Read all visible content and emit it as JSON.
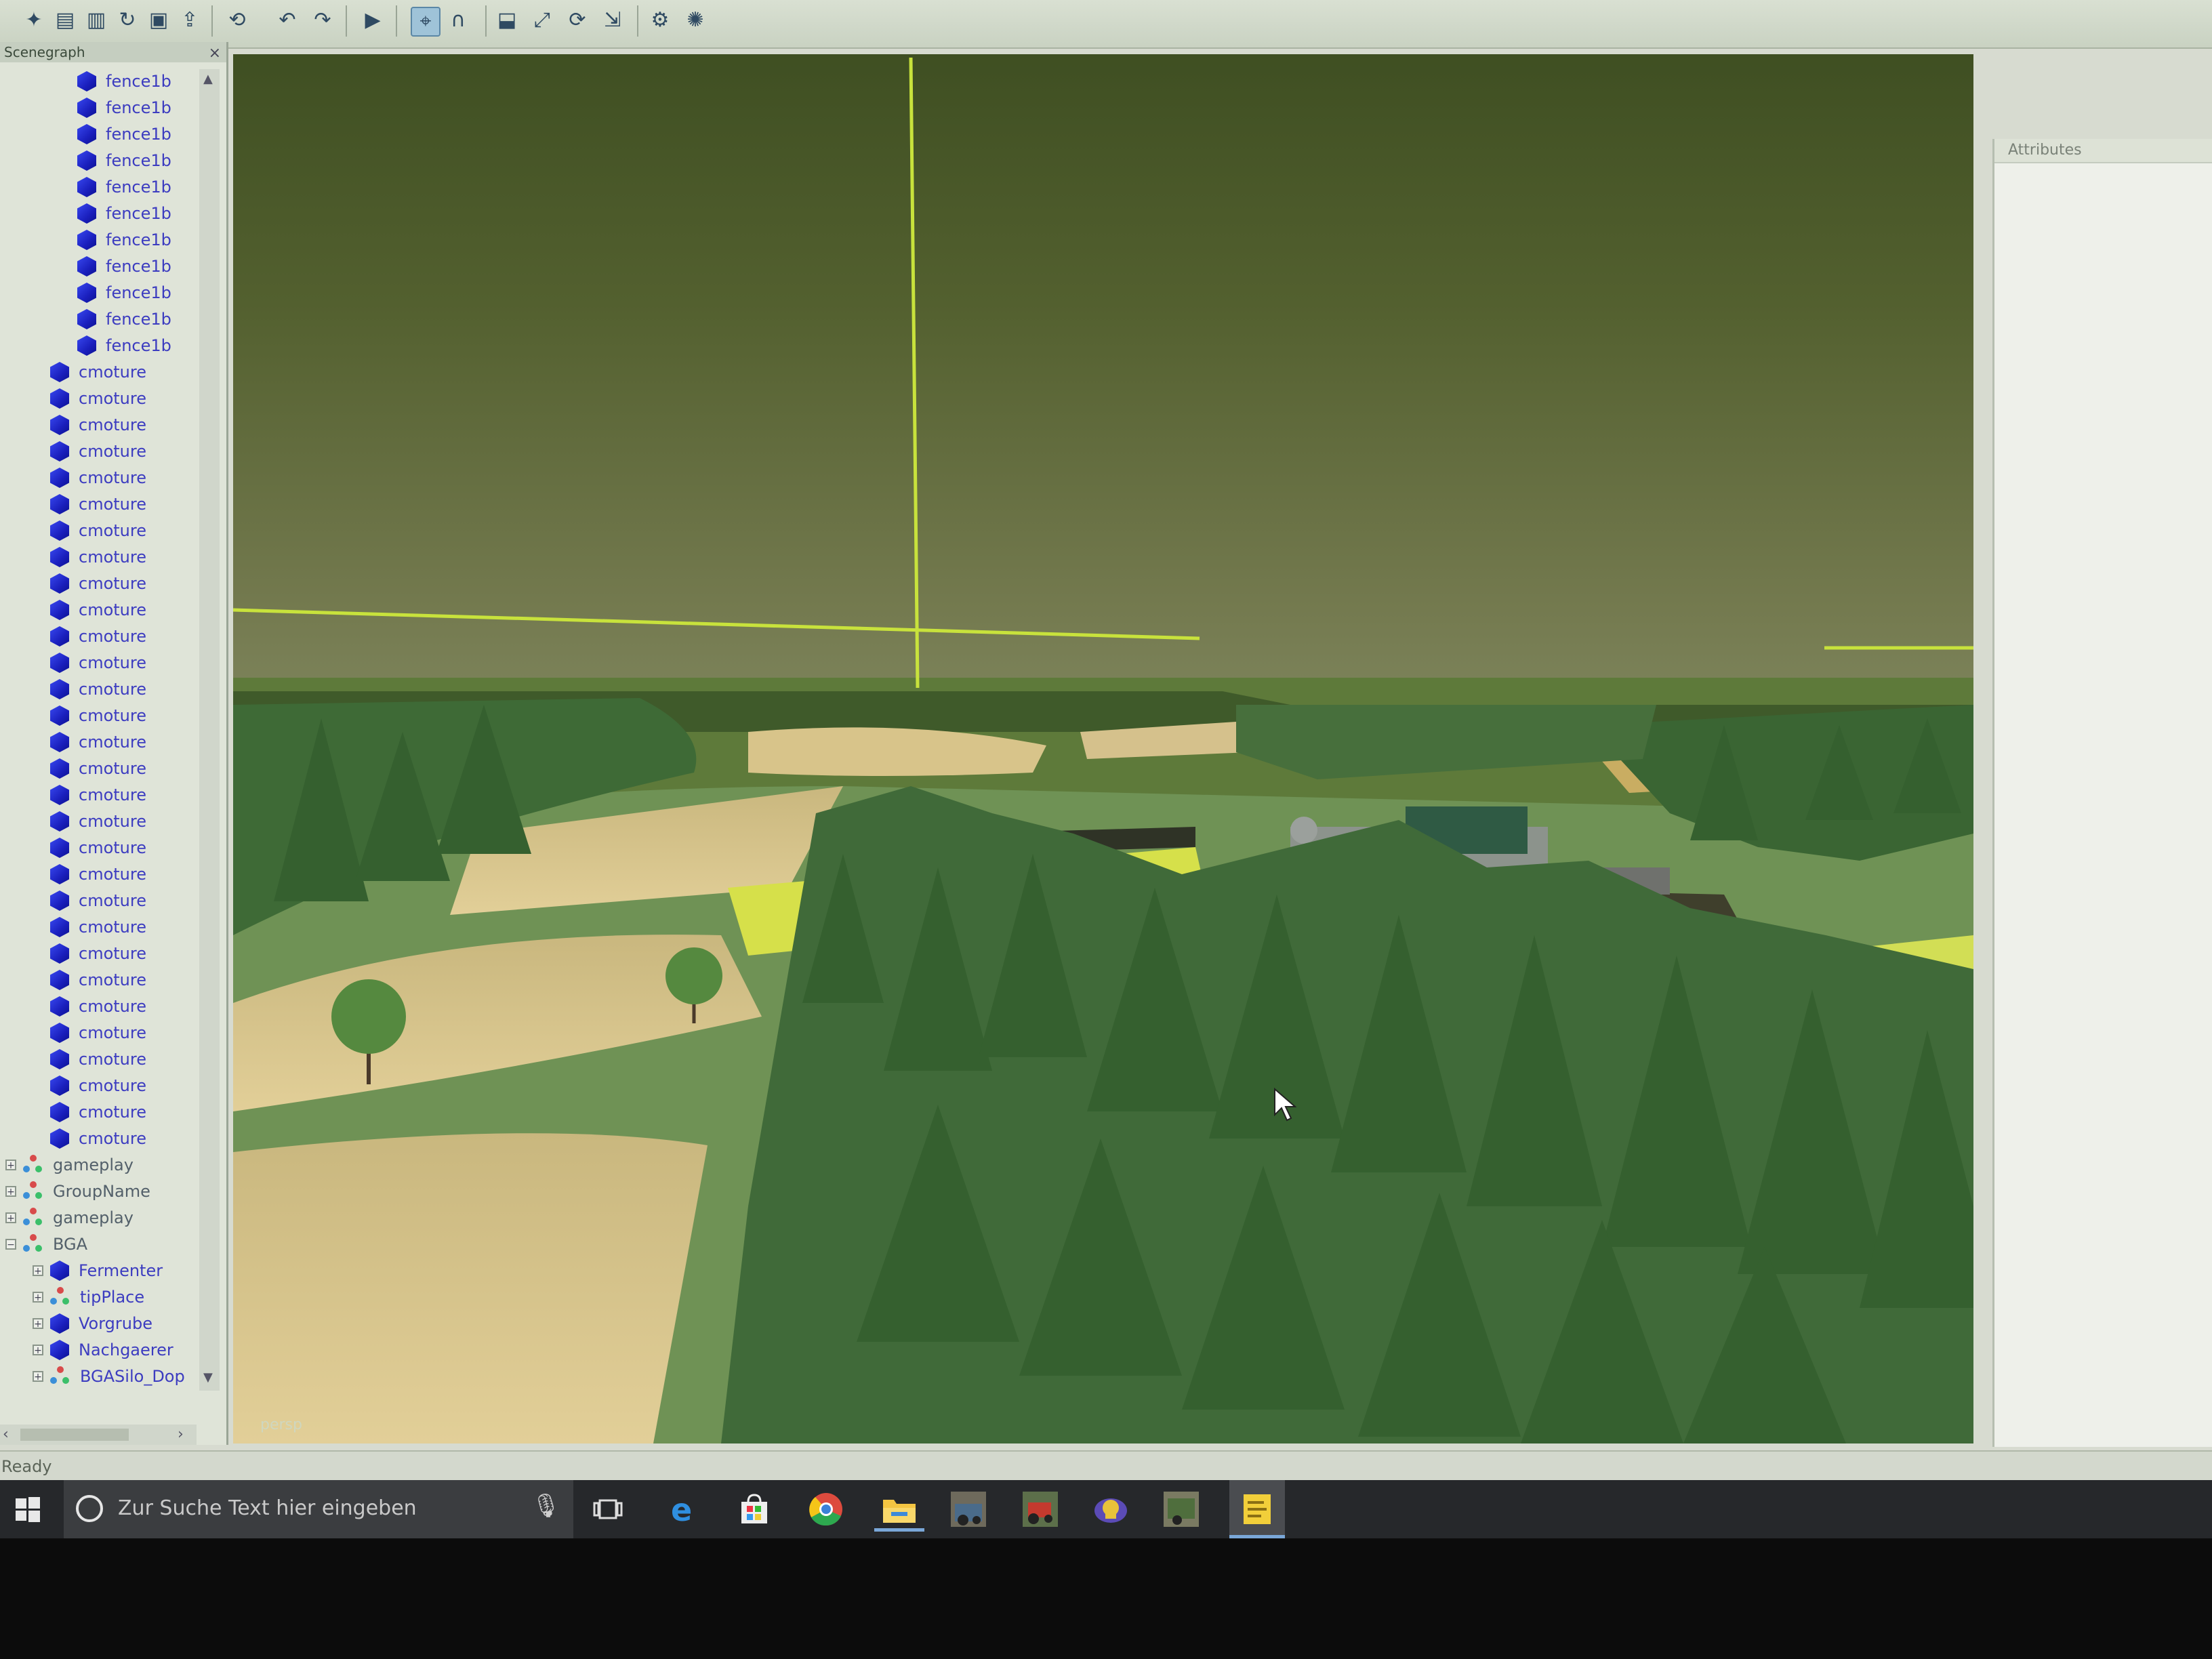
{
  "toolbar": {
    "buttons": [
      "new-file",
      "open-file",
      "save-file",
      "refresh",
      "save",
      "export",
      "undo-history",
      "undo",
      "redo",
      "play",
      "select-tool",
      "magnet-tool",
      "import",
      "move-tool",
      "rotate-tool",
      "scale-tool",
      "settings",
      "help"
    ]
  },
  "scenegraph": {
    "title": "Scenegraph",
    "close_glyph": "×",
    "nodes": [
      {
        "label": "fence1b",
        "icon": "shape",
        "indent": 2
      },
      {
        "label": "fence1b",
        "icon": "shape",
        "indent": 2
      },
      {
        "label": "fence1b",
        "icon": "shape",
        "indent": 2
      },
      {
        "label": "fence1b",
        "icon": "shape",
        "indent": 2
      },
      {
        "label": "fence1b",
        "icon": "shape",
        "indent": 2
      },
      {
        "label": "fence1b",
        "icon": "shape",
        "indent": 2
      },
      {
        "label": "fence1b",
        "icon": "shape",
        "indent": 2
      },
      {
        "label": "fence1b",
        "icon": "shape",
        "indent": 2
      },
      {
        "label": "fence1b",
        "icon": "shape",
        "indent": 2
      },
      {
        "label": "fence1b",
        "icon": "shape",
        "indent": 2
      },
      {
        "label": "fence1b",
        "icon": "shape",
        "indent": 2
      },
      {
        "label": "cmoture",
        "icon": "shape",
        "indent": 1
      },
      {
        "label": "cmoture",
        "icon": "shape",
        "indent": 1
      },
      {
        "label": "cmoture",
        "icon": "shape",
        "indent": 1
      },
      {
        "label": "cmoture",
        "icon": "shape",
        "indent": 1
      },
      {
        "label": "cmoture",
        "icon": "shape",
        "indent": 1
      },
      {
        "label": "cmoture",
        "icon": "shape",
        "indent": 1
      },
      {
        "label": "cmoture",
        "icon": "shape",
        "indent": 1
      },
      {
        "label": "cmoture",
        "icon": "shape",
        "indent": 1
      },
      {
        "label": "cmoture",
        "icon": "shape",
        "indent": 1
      },
      {
        "label": "cmoture",
        "icon": "shape",
        "indent": 1
      },
      {
        "label": "cmoture",
        "icon": "shape",
        "indent": 1
      },
      {
        "label": "cmoture",
        "icon": "shape",
        "indent": 1
      },
      {
        "label": "cmoture",
        "icon": "shape",
        "indent": 1
      },
      {
        "label": "cmoture",
        "icon": "shape",
        "indent": 1
      },
      {
        "label": "cmoture",
        "icon": "shape",
        "indent": 1
      },
      {
        "label": "cmoture",
        "icon": "shape",
        "indent": 1
      },
      {
        "label": "cmoture",
        "icon": "shape",
        "indent": 1
      },
      {
        "label": "cmoture",
        "icon": "shape",
        "indent": 1
      },
      {
        "label": "cmoture",
        "icon": "shape",
        "indent": 1
      },
      {
        "label": "cmoture",
        "icon": "shape",
        "indent": 1
      },
      {
        "label": "cmoture",
        "icon": "shape",
        "indent": 1
      },
      {
        "label": "cmoture",
        "icon": "shape",
        "indent": 1
      },
      {
        "label": "cmoture",
        "icon": "shape",
        "indent": 1
      },
      {
        "label": "cmoture",
        "icon": "shape",
        "indent": 1
      },
      {
        "label": "cmoture",
        "icon": "shape",
        "indent": 1
      },
      {
        "label": "cmoture",
        "icon": "shape",
        "indent": 1
      },
      {
        "label": "cmoture",
        "icon": "shape",
        "indent": 1
      },
      {
        "label": "cmoture",
        "icon": "shape",
        "indent": 1
      },
      {
        "label": "cmoture",
        "icon": "shape",
        "indent": 1
      },
      {
        "label": "cmoture",
        "icon": "shape",
        "indent": 1
      },
      {
        "label": "gameplay",
        "icon": "transformgroup",
        "indent": 0,
        "expander": "+"
      },
      {
        "label": "GroupName",
        "icon": "transformgroup",
        "indent": 0,
        "expander": "+"
      },
      {
        "label": "gameplay",
        "icon": "transformgroup",
        "indent": 0,
        "expander": "+"
      },
      {
        "label": "BGA",
        "icon": "transformgroup",
        "indent": 0,
        "expander": "−"
      },
      {
        "label": "Fermenter",
        "icon": "shape",
        "indent": 1,
        "expander": "+"
      },
      {
        "label": "tipPlace",
        "icon": "transformgroup",
        "indent": 1,
        "expander": "+"
      },
      {
        "label": "Vorgrube",
        "icon": "shape",
        "indent": 1,
        "expander": "+"
      },
      {
        "label": "Nachgaerer",
        "icon": "shape",
        "indent": 1,
        "expander": "+"
      },
      {
        "label": "BGASilo_Dop",
        "icon": "transformgroup",
        "indent": 1,
        "expander": "+"
      }
    ]
  },
  "viewport": {
    "label": "persp"
  },
  "attributes": {
    "title": "Attributes"
  },
  "status": {
    "text": "Ready"
  },
  "taskbar": {
    "search_placeholder": "Zur Suche Text hier eingeben",
    "apps": [
      "task-view",
      "edge",
      "store",
      "chrome",
      "file-explorer",
      "farming-simulator-1",
      "farming-simulator-2",
      "app-3",
      "farming-simulator-3",
      "giants-editor"
    ]
  }
}
